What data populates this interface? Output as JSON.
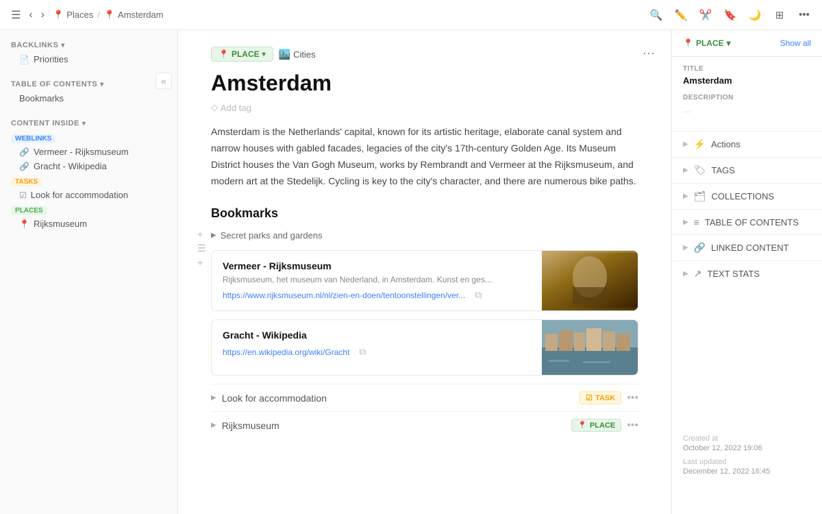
{
  "topbar": {
    "breadcrumb_places": "Places",
    "breadcrumb_current": "Amsterdam",
    "places_icon": "📍",
    "amsterdam_icon": "📍"
  },
  "left_sidebar": {
    "collapse_hint": "«",
    "backlinks_label": "BACKLINKS",
    "toc_label": "TABLE OF CONTENTS",
    "toc_item": "Bookmarks",
    "content_inside_label": "CONTENT INSIDE",
    "weblinks_tag": "WEBLINKS",
    "weblinks_items": [
      "Vermeer - Rijksmuseum",
      "Gracht - Wikipedia"
    ],
    "tasks_tag": "TASKS",
    "tasks_items": [
      "Look for accommodation"
    ],
    "places_tag": "PLACES",
    "places_items": [
      "Rijksmuseum"
    ]
  },
  "content": {
    "place_badge": "PLACE",
    "cities_label": "Cities",
    "cities_emoji": "🏙️",
    "title": "Amsterdam",
    "add_tag_label": "Add tag",
    "description": "Amsterdam is the Netherlands' capital, known for its artistic heritage, elaborate canal system and narrow houses with gabled facades, legacies of the city's 17th-century Golden Age. Its Museum District houses the Van Gogh Museum, works by Rembrandt and Vermeer at the Rijksmuseum, and modern art at the Stedelijk. Cycling is key to the city's character, and there are numerous bike paths.",
    "bookmarks_title": "Bookmarks",
    "secret_parks_label": "Secret parks and gardens",
    "bookmark1_title": "Vermeer - Rijksmuseum",
    "bookmark1_desc": "Rijksmuseum, het museum van Nederland, in Amsterdam. Kunst en ges...",
    "bookmark1_url": "https://www.rijksmuseum.nl/nl/zien-en-doen/tentoonstellingen/ver...",
    "bookmark2_title": "Gracht - Wikipedia",
    "bookmark2_url": "https://en.wikipedia.org/wiki/Gracht",
    "item1_label": "Look for accommodation",
    "item1_badge": "TASK",
    "item1_badge_icon": "☑",
    "item2_label": "Rijksmuseum",
    "item2_badge": "PLACE",
    "item2_badge_icon": "📍"
  },
  "right_panel": {
    "place_selector": "PLACE",
    "show_all": "Show all",
    "title_label": "TITLE",
    "title_value": "Amsterdam",
    "description_label": "DESCRIPTION",
    "description_dots": "...",
    "actions_label": "Actions",
    "tags_label": "TAGS",
    "collections_label": "COLLECTIONS",
    "toc_label": "TABLE OF CONTENTS",
    "linked_content_label": "LINKED CONTENT",
    "text_stats_label": "TEXT STATS",
    "created_at_label": "Created at",
    "created_at_value": "October 12, 2022 19:06",
    "last_updated_label": "Last updated",
    "last_updated_value": "December 12, 2022 16:45"
  }
}
